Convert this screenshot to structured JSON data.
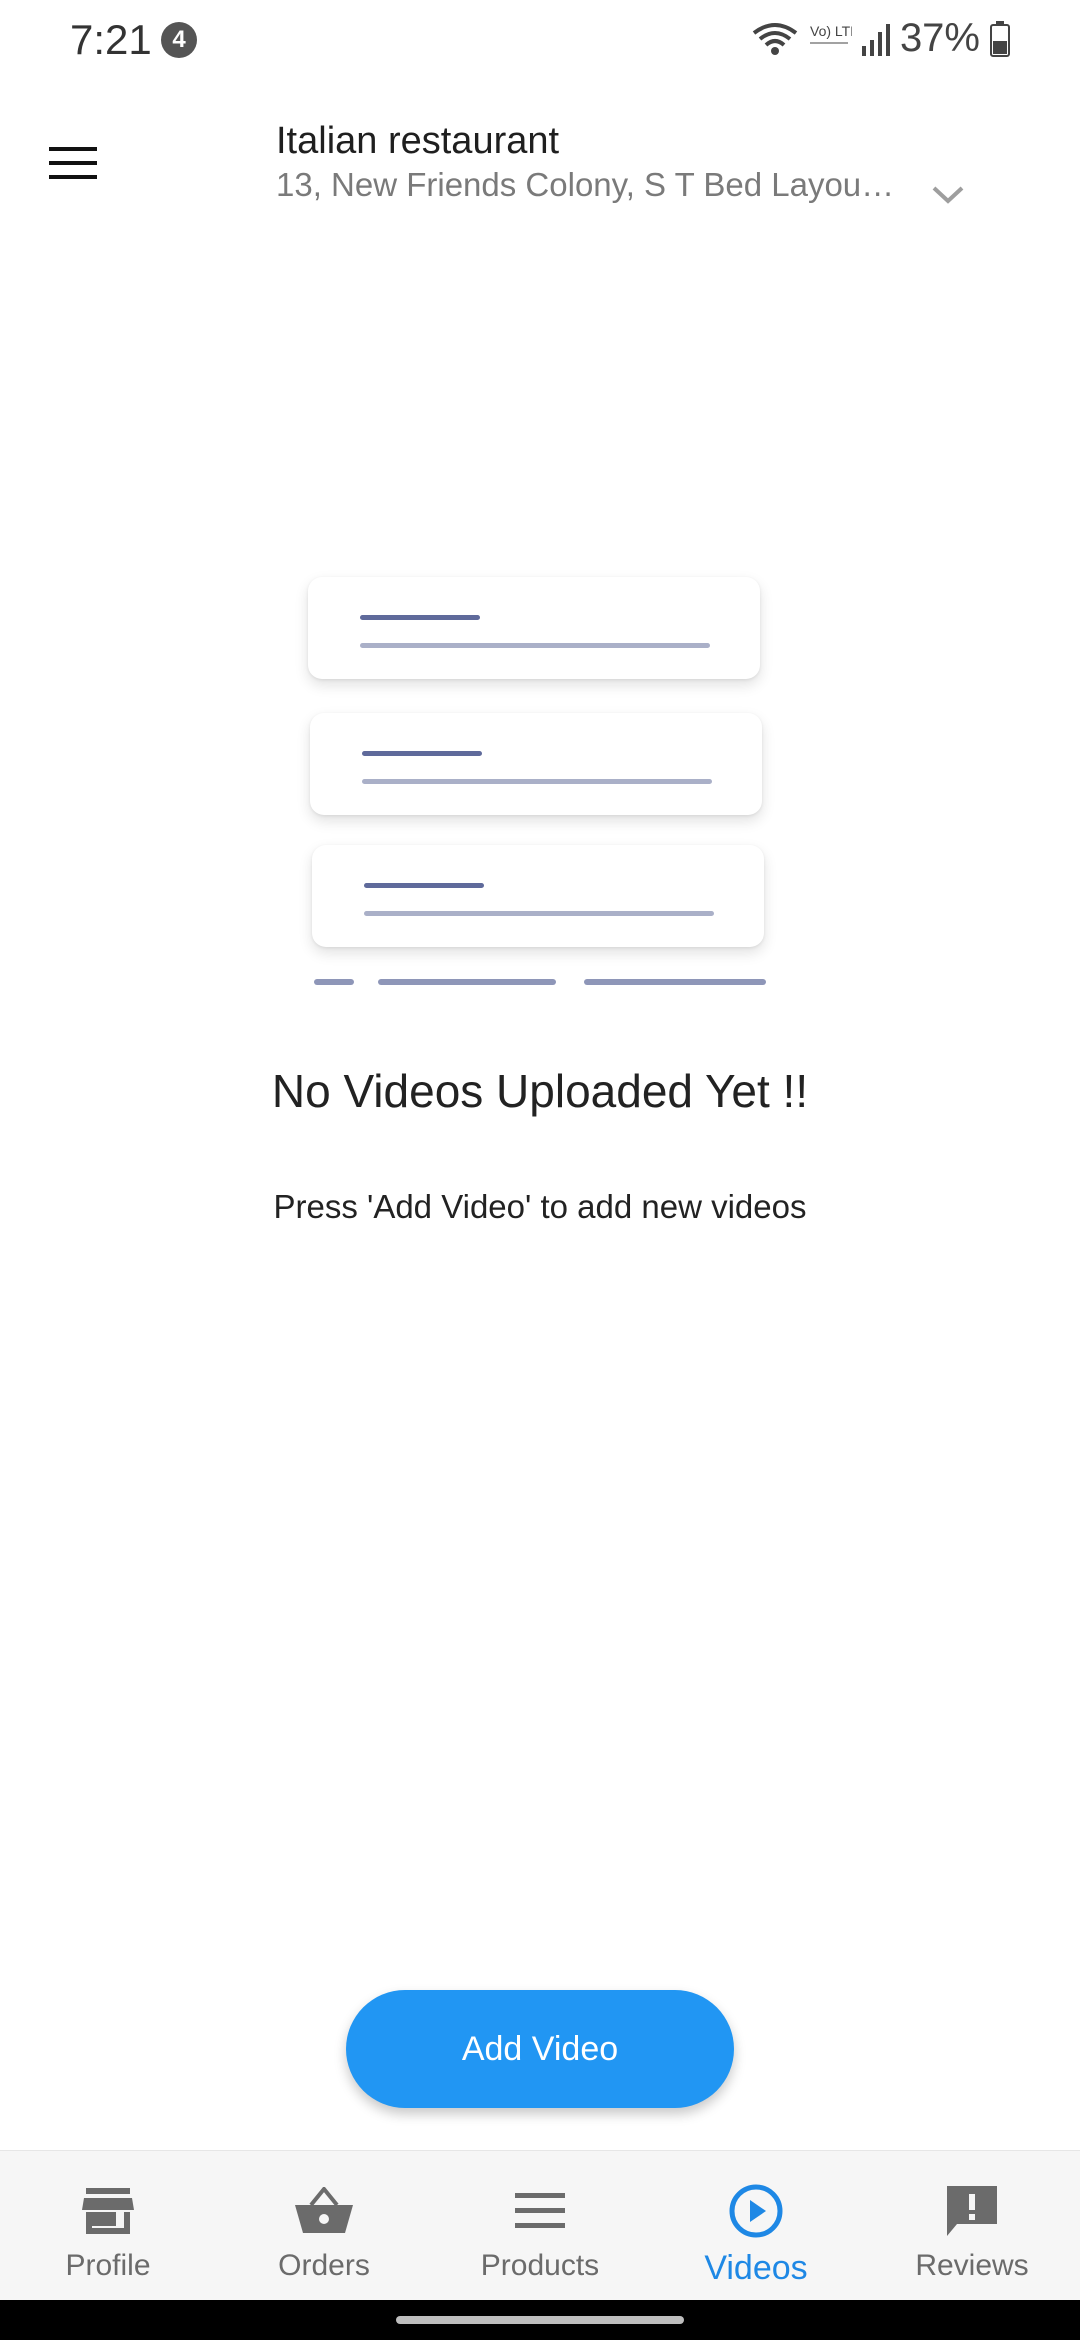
{
  "status_bar": {
    "time": "7:21",
    "notification_count": "4",
    "network_label": "Vo) LTE1",
    "battery": "37%"
  },
  "header": {
    "title": "Italian restaurant",
    "address": "13, New Friends Colony, S T Bed Layout, …"
  },
  "empty_state": {
    "title": "No Videos Uploaded Yet !!",
    "subtitle": "Press 'Add Video' to add new videos"
  },
  "actions": {
    "add_video_label": "Add Video"
  },
  "bottom_nav": {
    "items": [
      {
        "label": "Profile",
        "icon": "store-icon"
      },
      {
        "label": "Orders",
        "icon": "basket-icon"
      },
      {
        "label": "Products",
        "icon": "list-icon"
      },
      {
        "label": "Videos",
        "icon": "play-circle-icon",
        "active": true
      },
      {
        "label": "Reviews",
        "icon": "feedback-icon"
      }
    ]
  },
  "colors": {
    "accent": "#2196f3",
    "active_nav": "#1e88e5",
    "inactive_nav": "#6b6b6b"
  }
}
